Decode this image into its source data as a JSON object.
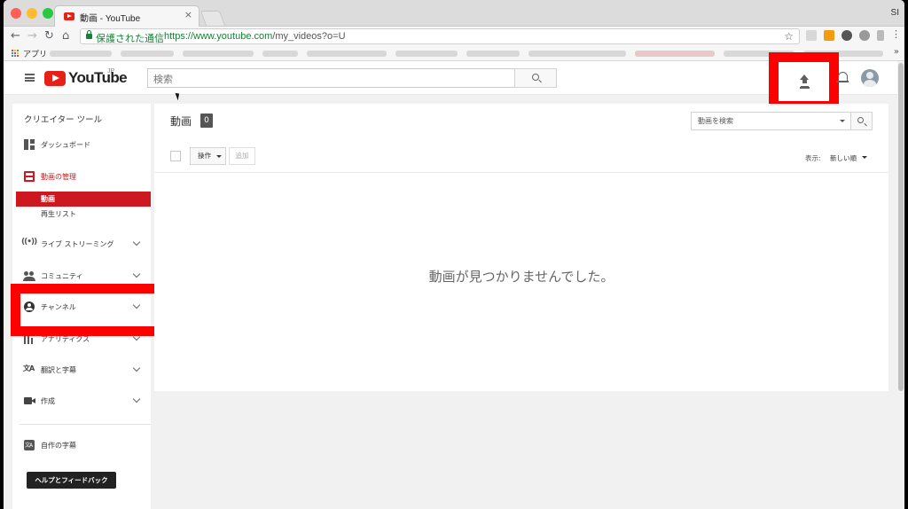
{
  "browser": {
    "tab_title": "動画 - YouTube",
    "tab_close": "×",
    "profile_initials": "SI",
    "secure_label": "保護された通信",
    "url_host": "https://www.youtube.com",
    "url_path": "/my_videos?o=U",
    "bookmarks_apps_label": "アプリ",
    "bookmarks_more": "»"
  },
  "header": {
    "wordmark": "YouTube",
    "country_code": "JP",
    "search_placeholder": "検索"
  },
  "sidebar": {
    "header": "クリエイター ツール",
    "items": [
      {
        "label": "ダッシュボード"
      },
      {
        "label": "動画の管理"
      },
      {
        "label": "ライブ ストリーミング"
      },
      {
        "label": "コミュニティ"
      },
      {
        "label": "チャンネル"
      },
      {
        "label": "アナリティクス"
      },
      {
        "label": "翻訳と字幕"
      },
      {
        "label": "作成"
      },
      {
        "label": "自作の字幕"
      }
    ],
    "sub_items": [
      {
        "label": "動画"
      },
      {
        "label": "再生リスト"
      }
    ],
    "help_button": "ヘルプとフィードバック"
  },
  "main": {
    "title": "動画",
    "video_count": "0",
    "search_placeholder": "動画を検索",
    "action_button": "操作",
    "add_button": "追加",
    "sort_label": "表示:",
    "sort_value": "新しい順",
    "empty_message": "動画が見つかりませんでした。"
  },
  "colors": {
    "brand_red": "#e62117",
    "highlight_red": "#ff0000",
    "active_item": "#cc181e",
    "secure_green": "#188038"
  }
}
